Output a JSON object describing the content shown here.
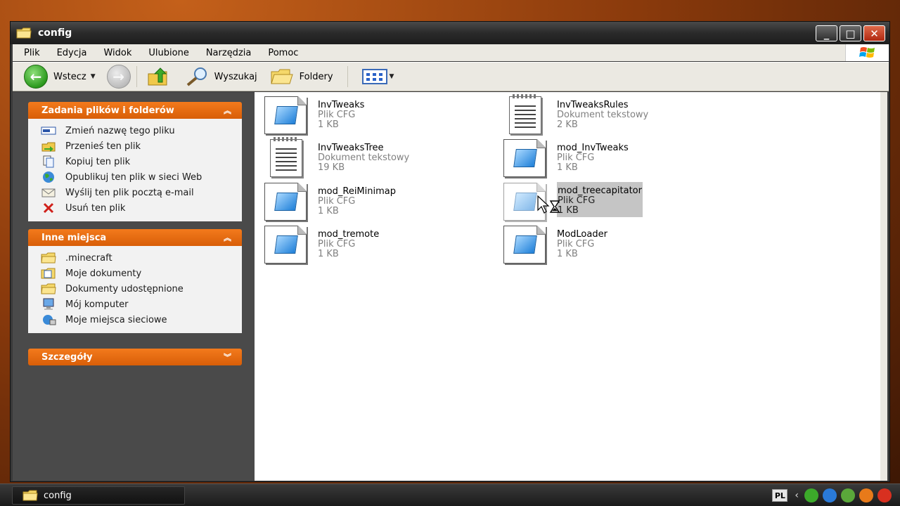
{
  "window": {
    "title": "config",
    "controls": [
      "_",
      "□",
      "✕"
    ]
  },
  "menu": [
    "Plik",
    "Edycja",
    "Widok",
    "Ulubione",
    "Narzędzia",
    "Pomoc"
  ],
  "toolbar": {
    "back_label": "Wstecz",
    "search_label": "Wyszukaj",
    "folders_label": "Foldery"
  },
  "panels": {
    "tasks": {
      "title": "Zadania plików i folderów",
      "items": [
        {
          "label": "Zmień nazwę tego pliku",
          "icon": "rename-icon"
        },
        {
          "label": "Przenieś ten plik",
          "icon": "move-icon"
        },
        {
          "label": "Kopiuj ten plik",
          "icon": "copy-icon"
        },
        {
          "label": "Opublikuj ten plik w sieci Web",
          "icon": "publish-web-icon"
        },
        {
          "label": "Wyślij ten plik pocztą e-mail",
          "icon": "email-icon"
        },
        {
          "label": "Usuń ten plik",
          "icon": "delete-icon"
        }
      ]
    },
    "places": {
      "title": "Inne miejsca",
      "items": [
        {
          "label": ".minecraft",
          "icon": "folder-icon"
        },
        {
          "label": "Moje dokumenty",
          "icon": "my-documents-icon"
        },
        {
          "label": "Dokumenty udostępnione",
          "icon": "shared-folder-icon"
        },
        {
          "label": "Mój komputer",
          "icon": "my-computer-icon"
        },
        {
          "label": "Moje miejsca sieciowe",
          "icon": "network-places-icon"
        }
      ]
    },
    "details": {
      "title": "Szczegóły"
    }
  },
  "files": [
    {
      "name": "InvTweaks",
      "type": "Plik CFG",
      "size": "1 KB",
      "icon": "cfg-file-icon"
    },
    {
      "name": "InvTweaksRules",
      "type": "Dokument tekstowy",
      "size": "2 KB",
      "icon": "text-document-icon"
    },
    {
      "name": "InvTweaksTree",
      "type": "Dokument tekstowy",
      "size": "19 KB",
      "icon": "text-document-icon"
    },
    {
      "name": "mod_InvTweaks",
      "type": "Plik CFG",
      "size": "1 KB",
      "icon": "cfg-file-icon"
    },
    {
      "name": "mod_ReiMinimap",
      "type": "Plik CFG",
      "size": "1 KB",
      "icon": "cfg-file-icon"
    },
    {
      "name": "mod_treecapitator",
      "type": "Plik CFG",
      "size": "1 KB",
      "icon": "cfg-file-icon",
      "selected": true
    },
    {
      "name": "mod_tremote",
      "type": "Plik CFG",
      "size": "1 KB",
      "icon": "cfg-file-icon"
    },
    {
      "name": "ModLoader",
      "type": "Plik CFG",
      "size": "1 KB",
      "icon": "cfg-file-icon"
    }
  ],
  "taskbar": {
    "task_label": "config",
    "language": "PL"
  },
  "colors": {
    "panel_header": "#f37a1c",
    "selection": "#c5c5c5",
    "title_bar": "#2a2a2a"
  }
}
